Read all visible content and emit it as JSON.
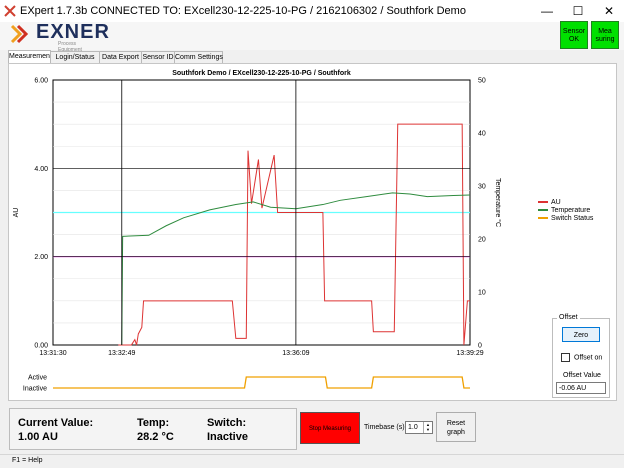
{
  "window": {
    "title": "EXpert 1.7.3b    CONNECTED TO: EXcell230-12-225-10-PG / 2162106302 / Southfork Demo",
    "minimize": "—",
    "maximize": "☐",
    "close": "✕"
  },
  "header": {
    "logo_text": "EXNER",
    "logo_sub": "Process Equipment",
    "sensor_ok": "Sensor OK",
    "measuring": "Mea suring",
    "sensor_ok_color": "#00e000",
    "measuring_color": "#00e000"
  },
  "tabs": [
    {
      "label": "Measurement",
      "active": true
    },
    {
      "label": "Login/Status",
      "active": false
    },
    {
      "label": "Data Export",
      "active": false
    },
    {
      "label": "Sensor ID",
      "active": false
    },
    {
      "label": "Comm Settings",
      "active": false
    }
  ],
  "chart_data": {
    "type": "line",
    "title": "Southfork Demo / EXcell230-12-225-10-PG / Southfork",
    "ylabel": "AU",
    "y2label": "Temperature °C",
    "ylim": [
      0,
      6
    ],
    "y2lim": [
      0,
      50
    ],
    "y_ticks": [
      "0.00",
      "2.00",
      "4.00",
      "6.00"
    ],
    "y2_ticks": [
      "0",
      "10",
      "20",
      "30",
      "40",
      "50"
    ],
    "x_ticks": [
      "13:31:30",
      "13:32:49",
      "13:36:09",
      "13:39:29"
    ],
    "x_start": "13:31:30",
    "x_end": "13:39:29",
    "switch_levels": [
      "Active",
      "Inactive"
    ],
    "reference_lines": [
      {
        "axis": "AU",
        "value": 3.0,
        "color": "#66ffff"
      },
      {
        "axis": "AU",
        "value": 2.0,
        "color": "#ee55ee"
      }
    ],
    "markers": [
      "13:32:49",
      "13:36:09"
    ],
    "series": [
      {
        "name": "AU",
        "axis": "AU",
        "color": "#dd3333",
        "points": [
          [
            "13:32:45",
            0.0
          ],
          [
            "13:33:00",
            0.0
          ],
          [
            "13:33:04",
            0.12
          ],
          [
            "13:33:06",
            0.0
          ],
          [
            "13:33:08",
            0.25
          ],
          [
            "13:33:12",
            0.4
          ],
          [
            "13:33:14",
            1.0
          ],
          [
            "13:34:50",
            1.0
          ],
          [
            "13:34:56",
            1.0
          ],
          [
            "13:35:00",
            0.15
          ],
          [
            "13:35:12",
            0.15
          ],
          [
            "13:35:14",
            4.4
          ],
          [
            "13:35:18",
            3.2
          ],
          [
            "13:35:26",
            4.2
          ],
          [
            "13:35:30",
            3.1
          ],
          [
            "13:35:44",
            4.3
          ],
          [
            "13:35:48",
            3.0
          ],
          [
            "13:36:10",
            3.0
          ],
          [
            "13:36:40",
            3.0
          ],
          [
            "13:36:42",
            1.0
          ],
          [
            "13:37:36",
            1.0
          ],
          [
            "13:37:38",
            0.3
          ],
          [
            "13:38:02",
            0.3
          ],
          [
            "13:38:06",
            5.0
          ],
          [
            "13:39:20",
            5.0
          ],
          [
            "13:39:22",
            0.0
          ],
          [
            "13:39:26",
            1.0
          ],
          [
            "13:39:29",
            1.0
          ]
        ]
      },
      {
        "name": "Temperature",
        "axis": "Temperature °C",
        "color": "#2e8b3e",
        "points": [
          [
            "13:32:49",
            0.0
          ],
          [
            "13:32:50",
            20.5
          ],
          [
            "13:33:20",
            20.7
          ],
          [
            "13:33:40",
            22.5
          ],
          [
            "13:34:00",
            24.0
          ],
          [
            "13:34:30",
            25.5
          ],
          [
            "13:35:00",
            26.5
          ],
          [
            "13:35:20",
            27.0
          ],
          [
            "13:35:40",
            26.0
          ],
          [
            "13:36:09",
            25.7
          ],
          [
            "13:36:40",
            26.5
          ],
          [
            "13:37:00",
            27.3
          ],
          [
            "13:37:30",
            28.0
          ],
          [
            "13:38:00",
            28.7
          ],
          [
            "13:38:20",
            28.5
          ],
          [
            "13:38:40",
            28.0
          ],
          [
            "13:39:10",
            28.2
          ],
          [
            "13:39:29",
            28.3
          ]
        ]
      },
      {
        "name": "Switch Status",
        "axis": "switch",
        "color": "#f0a000",
        "points": [
          [
            "13:31:30",
            0
          ],
          [
            "13:35:10",
            0
          ],
          [
            "13:35:12",
            1
          ],
          [
            "13:36:43",
            1
          ],
          [
            "13:36:45",
            0
          ],
          [
            "13:37:36",
            0
          ],
          [
            "13:37:38",
            1
          ],
          [
            "13:39:20",
            1
          ],
          [
            "13:39:22",
            0
          ],
          [
            "13:39:29",
            0
          ]
        ]
      }
    ]
  },
  "offset": {
    "label": "Offset",
    "zero_button": "Zero",
    "offset_on_label": "Offset on",
    "value_label": "Offset Value",
    "value": "-0.06 AU"
  },
  "status": {
    "current_label": "Current Value:",
    "current_value": "1.00 AU",
    "temp_label": "Temp:",
    "temp_value": "28.2 °C",
    "switch_label": "Switch:",
    "switch_value": "Inactive"
  },
  "controls": {
    "stop_button": "Stop Measuring",
    "stop_color": "#ff0000",
    "timebase_label": "Timebase (s)",
    "timebase_value": "1.0",
    "reset_button": "Reset graph"
  },
  "statusbar": {
    "text": "F1 = Help"
  }
}
